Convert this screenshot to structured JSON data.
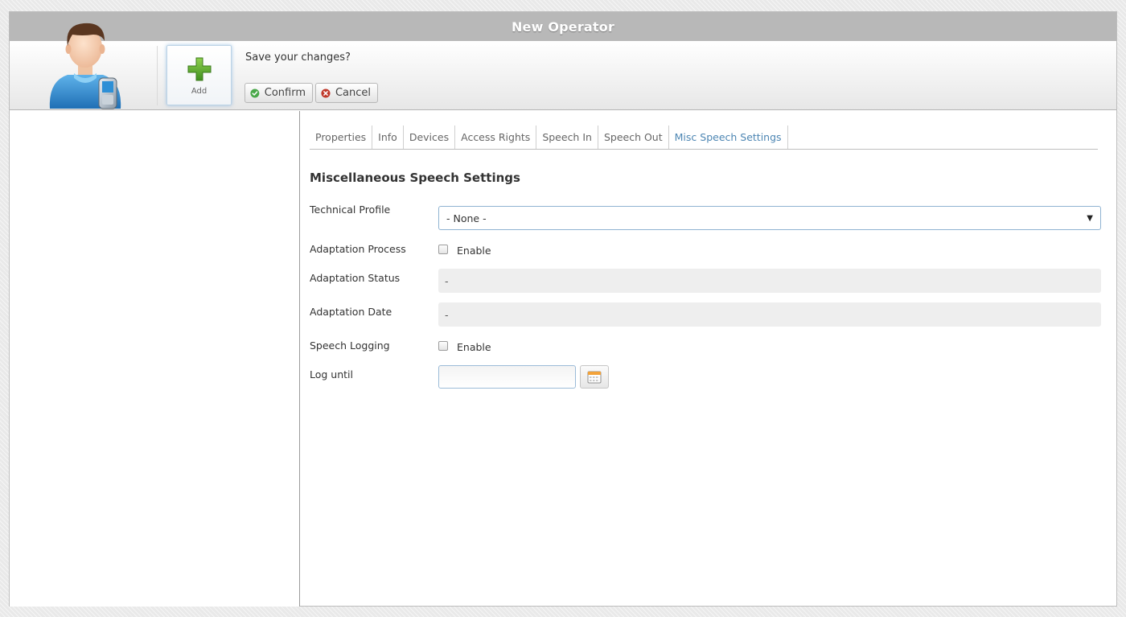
{
  "window": {
    "title": "New Operator"
  },
  "header": {
    "avatar_icon": "operator-with-phone-icon",
    "add_button": {
      "label": "Add",
      "icon": "plus-icon"
    },
    "save_prompt": "Save your changes?",
    "confirm_label": "Confirm",
    "cancel_label": "Cancel"
  },
  "tabs": [
    {
      "label": "Properties"
    },
    {
      "label": "Info"
    },
    {
      "label": "Devices"
    },
    {
      "label": "Access Rights"
    },
    {
      "label": "Speech In"
    },
    {
      "label": "Speech Out"
    },
    {
      "label": "Misc Speech Settings",
      "active": true
    }
  ],
  "section_title": "Miscellaneous Speech Settings",
  "form": {
    "technical_profile": {
      "label": "Technical Profile",
      "value": "- None -"
    },
    "adaptation_process": {
      "label": "Adaptation Process",
      "checkbox_label": "Enable",
      "checked": false
    },
    "adaptation_status": {
      "label": "Adaptation Status",
      "value": "-"
    },
    "adaptation_date": {
      "label": "Adaptation Date",
      "value": "-"
    },
    "speech_logging": {
      "label": "Speech Logging",
      "checkbox_label": "Enable",
      "checked": false
    },
    "log_until": {
      "label": "Log until",
      "value": ""
    }
  },
  "colors": {
    "titlebar": "#b8b8b8",
    "active_tab": "#4d86b3",
    "confirm_icon": "#4aa84a",
    "cancel_icon": "#c0392b"
  }
}
